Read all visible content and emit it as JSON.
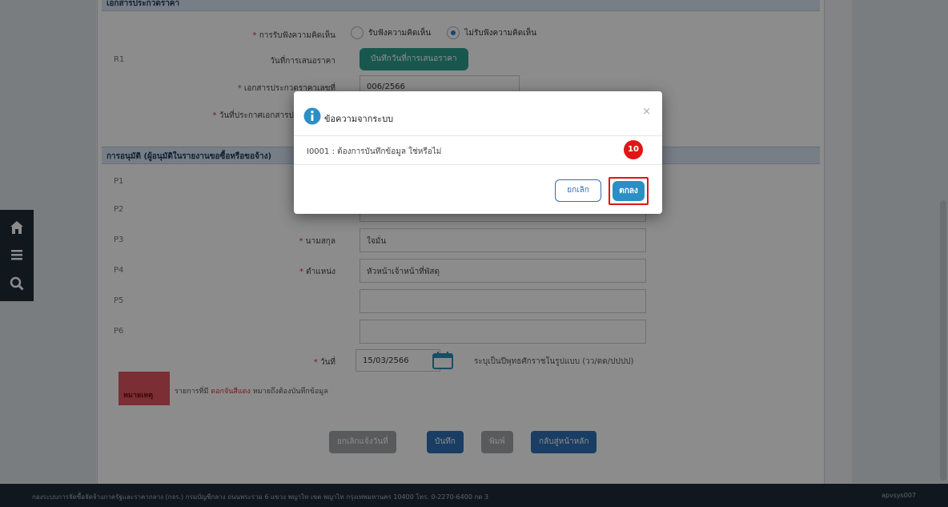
{
  "form": {
    "section1_title": "เอกสารประกวดราคา",
    "opinion_label": "การรับฟังความคิดเห็น",
    "opinion_option_yes": "รับฟังความคิดเห็น",
    "opinion_option_no": "ไม่รับฟังความคิดเห็น",
    "r1_code": "R1",
    "bid_date_label": "วันที่การเสนอราคา",
    "bid_date_button": "บันทึกวันที่การเสนอราคา",
    "doc_no_label": "เอกสารประกวดราคาเลขที่",
    "doc_no_value": "006/2566",
    "announce_date_label": "วันที่ประกาศเอกสารประกวดราคา",
    "section2_title": "การอนุมัติ (ผู้อนุมัติในรายงานขอซื้อหรือขอจ้าง)",
    "rows": [
      {
        "code": "P1",
        "label": "",
        "value": ""
      },
      {
        "code": "P2",
        "label": "",
        "value": ""
      },
      {
        "code": "P3",
        "label": "นามสกุล",
        "value": "ใจมั่น"
      },
      {
        "code": "P4",
        "label": "ตำแหน่ง",
        "value": "หัวหน้าเจ้าหน้าที่พัสดุ"
      },
      {
        "code": "P5",
        "label": "",
        "value": ""
      },
      {
        "code": "P6",
        "label": "",
        "value": ""
      }
    ],
    "date_label": "วันที่",
    "date_value": "15/03/2566",
    "date_hint": "ระบุเป็นปีพุทธศักราชในรูปแบบ (วว/ดด/ปปปป)",
    "remark_tag": "หมายเหตุ",
    "remark_text_pre": "รายการที่มี",
    "remark_text_highlight": "ดอกจันสีแดง",
    "remark_text_post": "หมายถึงต้องบันทึกข้อมูล"
  },
  "bottom_buttons": {
    "cancel_announce": "ยกเลิกแจ้งวันที่",
    "save": "บันทึก",
    "print": "พิมพ์",
    "back": "กลับสู่หน้าหลัก"
  },
  "footer": {
    "text": "กองระบบการจัดซื้อจัดจ้างภาครัฐและราคากลาง (กจร.) กรมบัญชีกลาง ถนนพระราม 6 แขวง พญาไท เขต พญาไท กรุงเทพมหานคร 10400 โทร. 0-2270-6400 กด 3",
    "user": "apvsys007"
  },
  "modal": {
    "title": "ข้อความจากระบบ",
    "message": "I0001 : ต้องการบันทึกข้อมูล ใช่หรือไม่",
    "cancel_label": "ยกเลิก",
    "ok_label": "ตกลง",
    "close_symbol": "×",
    "step_number": "10"
  },
  "icons": {
    "home": "home-icon",
    "menu": "menu-icon",
    "search": "search-icon",
    "info": "info-icon",
    "calendar": "calendar-icon"
  },
  "colors": {
    "teal": "#2c9f8f",
    "primary": "#2b8fc6",
    "highlight_red": "#e01515",
    "footer": "#1f2b38"
  }
}
